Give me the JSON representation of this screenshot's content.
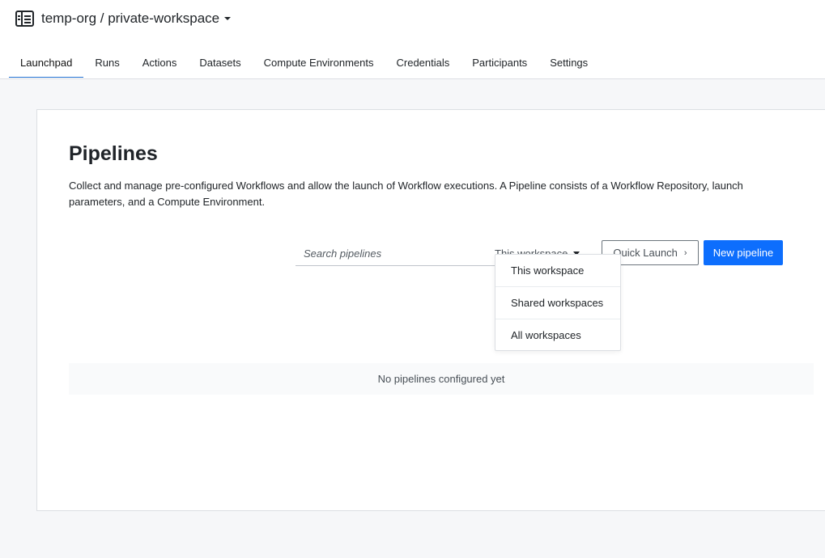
{
  "workspace": {
    "name": "temp-org / private-workspace",
    "icon": "workspace-grid-icon"
  },
  "tabs": [
    {
      "label": "Launchpad",
      "active": true
    },
    {
      "label": "Runs"
    },
    {
      "label": "Actions"
    },
    {
      "label": "Datasets"
    },
    {
      "label": "Compute Environments"
    },
    {
      "label": "Credentials"
    },
    {
      "label": "Participants"
    },
    {
      "label": "Settings"
    }
  ],
  "page": {
    "title": "Pipelines",
    "description": "Collect and manage pre-configured Workflows and allow the launch of Workflow executions. A Pipeline consists of a Workflow Repository, launch parameters, and a Compute Environment."
  },
  "toolbar": {
    "search_placeholder": "Search pipelines",
    "scope_selected": "This workspace",
    "quick_launch_label": "Quick Launch",
    "new_pipeline_label": "New pipeline"
  },
  "scope_menu": {
    "options": [
      "This workspace",
      "Shared workspaces",
      "All workspaces"
    ]
  },
  "empty_state": "No pipelines configured yet",
  "colors": {
    "accent": "#0d6efd",
    "tab_underline": "#1f6fd1",
    "page_background": "#f6f7f9"
  }
}
